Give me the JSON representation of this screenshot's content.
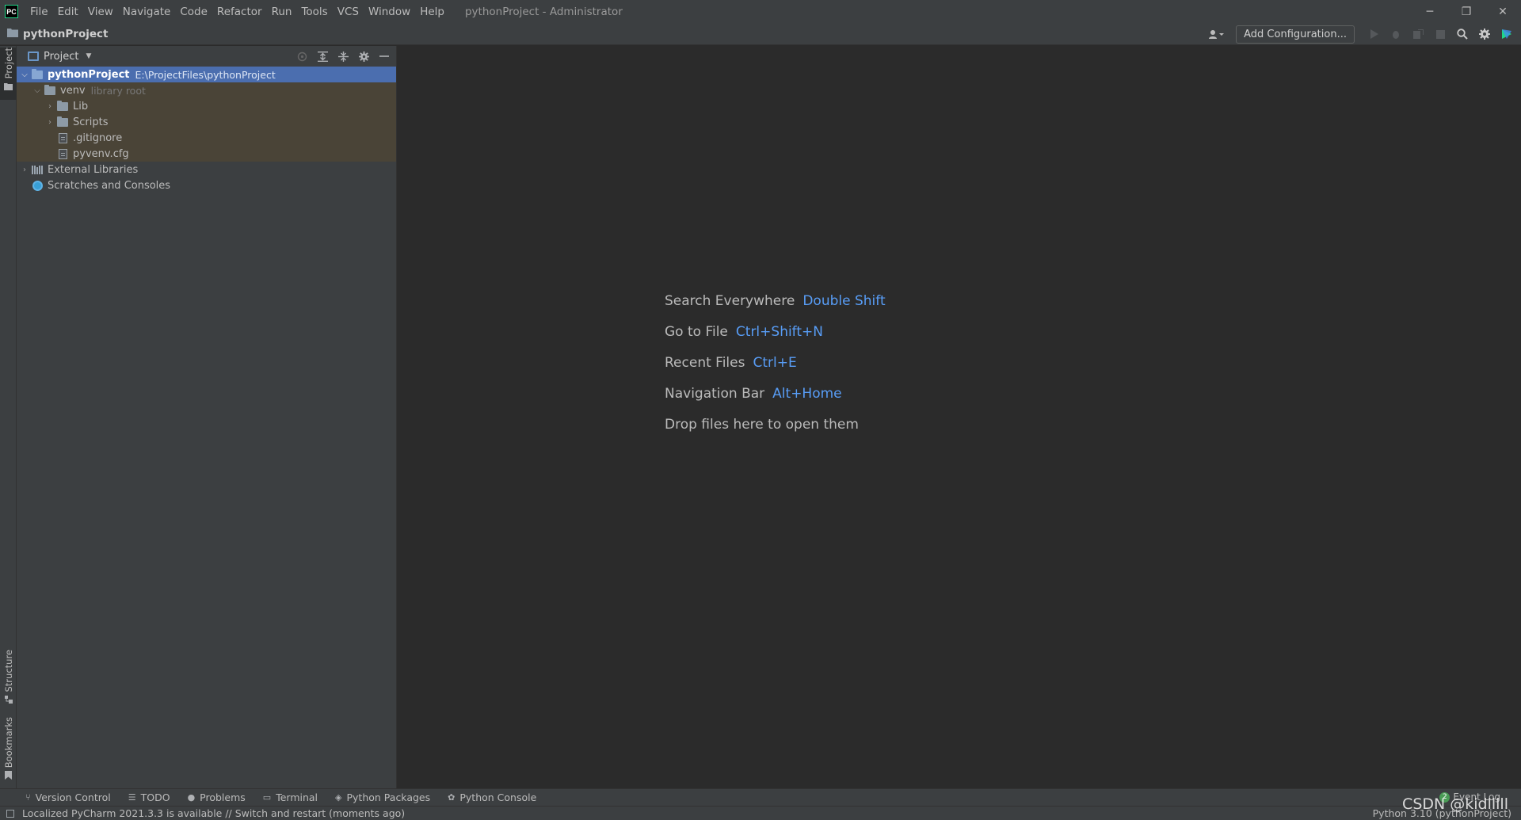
{
  "app": {
    "logo_text": "PC",
    "window_title": "pythonProject - Administrator",
    "menu": [
      "File",
      "Edit",
      "View",
      "Navigate",
      "Code",
      "Refactor",
      "Run",
      "Tools",
      "VCS",
      "Window",
      "Help"
    ]
  },
  "window_controls": {
    "minimize": "─",
    "restore": "❐",
    "close": "✕"
  },
  "navbar": {
    "breadcrumb": "pythonProject",
    "add_configuration": "Add Configuration..."
  },
  "left_stripe": {
    "project": "Project",
    "structure": "Structure",
    "bookmarks": "Bookmarks"
  },
  "project_panel": {
    "view_mode": "Project",
    "tree": [
      {
        "name": "pythonProject",
        "hint": "E:\\ProjectFiles\\pythonProject",
        "icon": "folder-blue-icon",
        "expanded": true
      },
      {
        "name": "venv",
        "hint": "library root",
        "icon": "folder-icon",
        "expanded": true
      },
      {
        "name": "Lib",
        "icon": "folder-icon",
        "expanded": false
      },
      {
        "name": "Scripts",
        "icon": "folder-icon",
        "expanded": false
      },
      {
        "name": ".gitignore",
        "icon": "file-icon"
      },
      {
        "name": "pyvenv.cfg",
        "icon": "file-icon"
      },
      {
        "name": "External Libraries",
        "icon": "libraries-icon",
        "expanded": false
      },
      {
        "name": "Scratches and Consoles",
        "icon": "scratches-icon"
      }
    ]
  },
  "editor_hints": [
    {
      "label": "Search Everywhere",
      "shortcut": "Double Shift"
    },
    {
      "label": "Go to File",
      "shortcut": "Ctrl+Shift+N"
    },
    {
      "label": "Recent Files",
      "shortcut": "Ctrl+E"
    },
    {
      "label": "Navigation Bar",
      "shortcut": "Alt+Home"
    },
    {
      "label": "Drop files here to open them",
      "shortcut": ""
    }
  ],
  "bottom_tools": [
    {
      "label": "Version Control",
      "icon": "version-control-icon",
      "glyph": "⑂"
    },
    {
      "label": "TODO",
      "icon": "todo-icon",
      "glyph": "☰"
    },
    {
      "label": "Problems",
      "icon": "problems-icon",
      "glyph": "●"
    },
    {
      "label": "Terminal",
      "icon": "terminal-icon",
      "glyph": "▭"
    },
    {
      "label": "Python Packages",
      "icon": "python-packages-icon",
      "glyph": "◈"
    },
    {
      "label": "Python Console",
      "icon": "python-console-icon",
      "glyph": "✿"
    }
  ],
  "event_log": {
    "badge": "2",
    "label": "Event Log"
  },
  "statusbar": {
    "message": "Localized PyCharm 2021.3.3 is available // Switch and restart (moments ago)",
    "interpreter": "Python 3.10 (pythonProject)"
  },
  "watermark": "CSDN @kidlllll",
  "colors": {
    "background": "#2b2b2b",
    "panel": "#3c3f41",
    "selection": "#4b6eaf",
    "highlight_row": "#4a4437",
    "shortcut_accent": "#589df6"
  }
}
